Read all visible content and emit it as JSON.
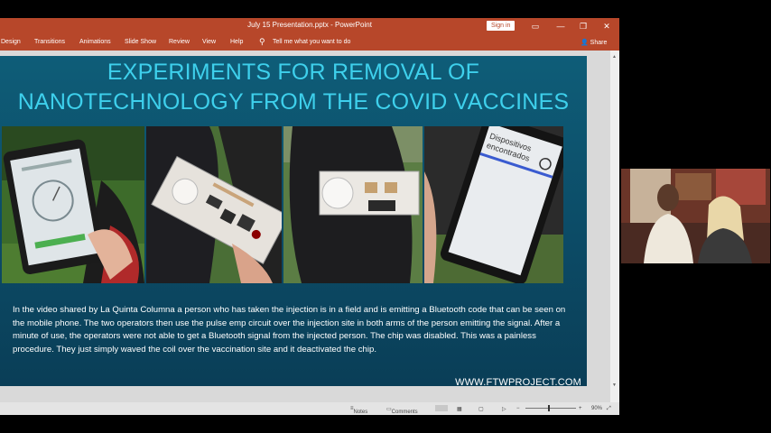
{
  "window": {
    "title": "July 15 Presentation.pptx - PowerPoint",
    "sign_in_label": "Sign in",
    "minimize_glyph": "—",
    "restore_glyph": "❐",
    "close_glyph": "✕"
  },
  "ribbon": {
    "tabs": [
      "Design",
      "Transitions",
      "Animations",
      "Slide Show",
      "Review",
      "View",
      "Help"
    ],
    "tell_me": "Tell me what you want to do",
    "share_label": "Share"
  },
  "slide": {
    "title_line1": "EXPERIMENTS FOR REMOVAL OF",
    "title_line2": "NANOTECHNOLOGY FROM THE COVID VACCINES",
    "photo4_screen_text_line1": "Dispositivos",
    "photo4_screen_text_line2": "encontrados",
    "description": "In the video shared by La Quinta Columna a person who has taken the injection is in a field and is emitting a Bluetooth code that can be seen on the mobile phone. The two operators then use the pulse emp circuit over the injection site in both arms of the person emitting the signal. After a minute of use, the operators were not able to get a Bluetooth signal from the injected person. The chip was disabled. This was a painless procedure. They just simply waved the coil over the vaccination site and it deactivated the chip.",
    "website": "WWW.FTWPROJECT.COM"
  },
  "statusbar": {
    "notes_label": "Notes",
    "comments_label": "Comments",
    "zoom": "90%"
  },
  "colors": {
    "accent": "#b7472a",
    "slide_title": "#3ed0ec",
    "slide_bg": "#0c4b66"
  }
}
